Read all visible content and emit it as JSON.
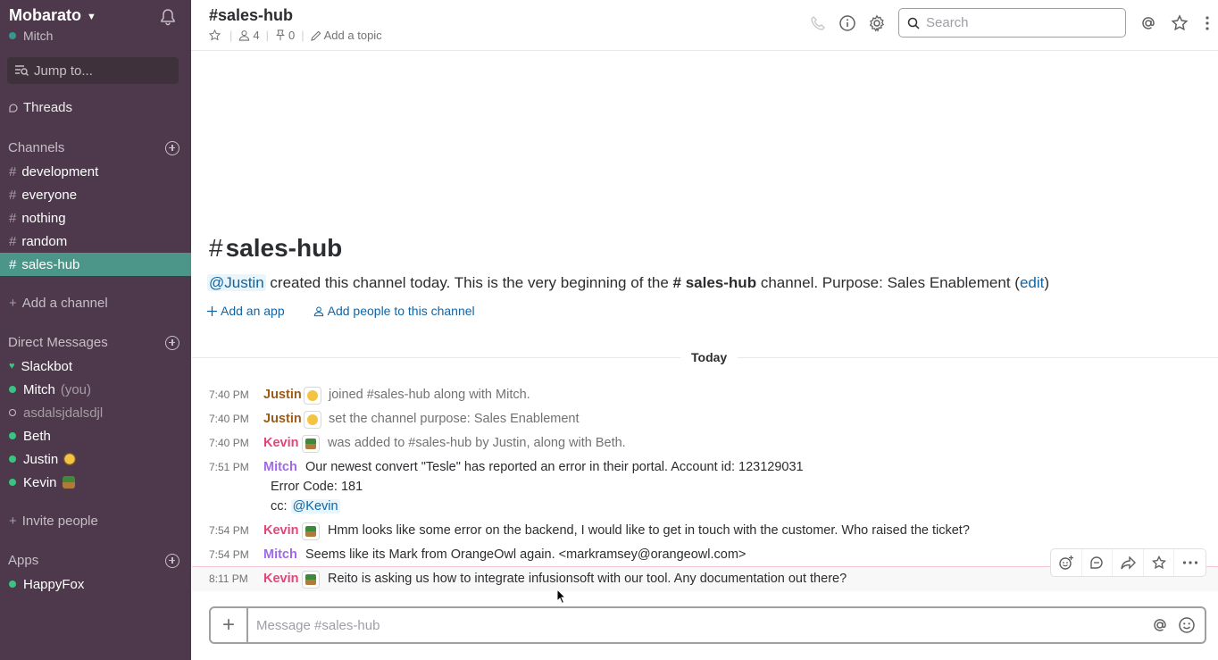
{
  "workspace": {
    "name": "Mobarato",
    "user": "Mitch"
  },
  "sidebar": {
    "jump_to": "Jump to...",
    "threads": "Threads",
    "channels_header": "Channels",
    "channels": [
      "development",
      "everyone",
      "nothing",
      "random",
      "sales-hub"
    ],
    "active_channel": "sales-hub",
    "add_channel": "Add a channel",
    "dm_header": "Direct Messages",
    "dms": [
      {
        "name": "Slackbot",
        "status": "heart"
      },
      {
        "name": "Mitch",
        "suffix": "(you)",
        "status": "online"
      },
      {
        "name": "asdalsjdalsdjl",
        "status": "away"
      },
      {
        "name": "Beth",
        "status": "online"
      },
      {
        "name": "Justin",
        "status": "online"
      },
      {
        "name": "Kevin",
        "status": "online"
      }
    ],
    "invite": "Invite people",
    "apps_header": "Apps",
    "apps": [
      "HappyFox"
    ]
  },
  "header": {
    "title": "#sales-hub",
    "members": "4",
    "pins": "0",
    "topic": "Add a topic",
    "search_placeholder": "Search"
  },
  "intro": {
    "title": "sales-hub",
    "mention": "@Justin",
    "text_a": "created this channel today. This is the very beginning of the",
    "channel": "sales-hub",
    "text_b": "channel. Purpose: Sales Enablement (",
    "edit": "edit",
    "close": ")",
    "add_app": "Add an app",
    "add_people": "Add people to this channel"
  },
  "divider": "Today",
  "messages": [
    {
      "time": "7:40 PM",
      "name": "Justin",
      "text": "joined #sales-hub along with Mitch."
    },
    {
      "time": "7:40 PM",
      "name": "Justin",
      "text": "set the channel purpose: Sales Enablement"
    },
    {
      "time": "7:40 PM",
      "name": "Kevin",
      "text": "was added to #sales-hub by Justin, along with Beth."
    },
    {
      "time": "7:51 PM",
      "name": "Mitch",
      "text": "Our newest convert \"Tesle\" has reported an error in their portal. Account id: 123129031",
      "line2": "Error Code: 181",
      "line3_prefix": "cc:",
      "line3_mention": "@Kevin"
    },
    {
      "time": "7:54 PM",
      "name": "Kevin",
      "text": "Hmm looks like some error on the backend, I would like to get in touch with the customer. Who raised the ticket?"
    },
    {
      "time": "7:54 PM",
      "name": "Mitch",
      "text": "Seems like its Mark from OrangeOwl again. <markramsey@orangeowl.com>"
    },
    {
      "time": "8:11 PM",
      "name": "Kevin",
      "text": "Reito is asking us how to integrate infusionsoft with our tool. Any documentation out there?"
    }
  ],
  "composer": {
    "placeholder": "Message #sales-hub"
  },
  "colors": {
    "sidebar": "#4d394b",
    "active": "#4c9689",
    "link": "#1264a3"
  }
}
